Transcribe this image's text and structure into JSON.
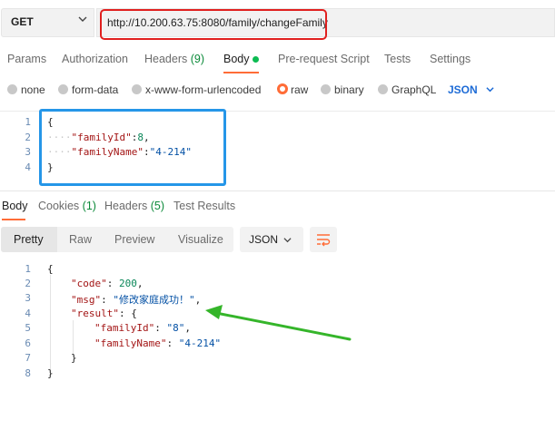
{
  "request": {
    "method": "GET",
    "url": "http://10.200.63.75:8080/family/changeFamily"
  },
  "request_tabs": [
    {
      "label": "Params"
    },
    {
      "label": "Authorization"
    },
    {
      "label": "Headers",
      "count": "(9)"
    },
    {
      "label": "Body"
    },
    {
      "label": "Pre-request Script"
    },
    {
      "label": "Tests"
    },
    {
      "label": "Settings"
    }
  ],
  "body_types": [
    "none",
    "form-data",
    "x-www-form-urlencoded",
    "raw",
    "binary",
    "GraphQL"
  ],
  "body_format": "JSON",
  "request_body": {
    "line_numbers": [
      "1",
      "2",
      "3",
      "4"
    ],
    "open_brace": "{",
    "close_brace": "}",
    "family_id_key": "\"familyId\"",
    "family_id_value": "8",
    "family_name_key": "\"familyName\"",
    "family_name_value": "\"4-214\""
  },
  "response_tabs": [
    {
      "label": "Body"
    },
    {
      "label": "Cookies",
      "count": "(1)"
    },
    {
      "label": "Headers",
      "count": "(5)"
    },
    {
      "label": "Test Results"
    }
  ],
  "view_modes": [
    "Pretty",
    "Raw",
    "Preview",
    "Visualize"
  ],
  "response_format": "JSON",
  "response_body": {
    "line_numbers": [
      "1",
      "2",
      "3",
      "4",
      "5",
      "6",
      "7",
      "8"
    ],
    "open_brace": "{",
    "close_brace": "}",
    "code_key": "\"code\"",
    "code_value": "200",
    "msg_key": "\"msg\"",
    "msg_value": "\"修改家庭成功！\"",
    "result_key": "\"result\"",
    "family_id_key": "\"familyId\"",
    "family_id_value": "\"8\"",
    "family_name_key": "\"familyName\"",
    "family_name_value": "\"4-214\""
  },
  "colors": {
    "accent": "#ff6c37",
    "annotation_red": "#e0201f",
    "annotation_blue": "#2596e8",
    "annotation_green": "#35b52a"
  }
}
